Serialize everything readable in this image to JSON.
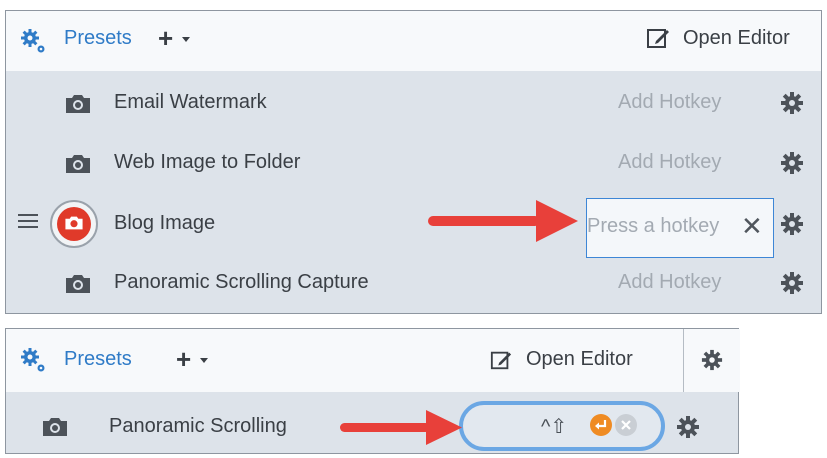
{
  "colors": {
    "accent_blue": "#2f7bc7",
    "arrow_red": "#e8403a",
    "capture_red": "#e03a2a",
    "enter_orange": "#ef8b23",
    "focus_blue": "#6ba7e4"
  },
  "top_panel": {
    "header": {
      "presets_label": "Presets",
      "add_label": "+",
      "open_editor_label": "Open Editor"
    },
    "rows": [
      {
        "name": "Email Watermark",
        "hotkey": "Add Hotkey",
        "icon": "camera-icon"
      },
      {
        "name": "Web Image to Folder",
        "hotkey": "Add Hotkey",
        "icon": "camera-icon"
      },
      {
        "name": "Blog Image",
        "hotkey_placeholder": "Press a hotkey",
        "clear_glyph": "✕",
        "icon": "camera-icon-red"
      },
      {
        "name": "Panoramic Scrolling Capture",
        "hotkey": "Add Hotkey",
        "icon": "camera-icon"
      }
    ]
  },
  "bottom_panel": {
    "header": {
      "presets_label": "Presets",
      "add_label": "+",
      "open_editor_label": "Open Editor"
    },
    "row": {
      "name": "Panoramic Scrolling",
      "hotkey_modifiers": "^⇧",
      "icon": "camera-icon"
    }
  }
}
